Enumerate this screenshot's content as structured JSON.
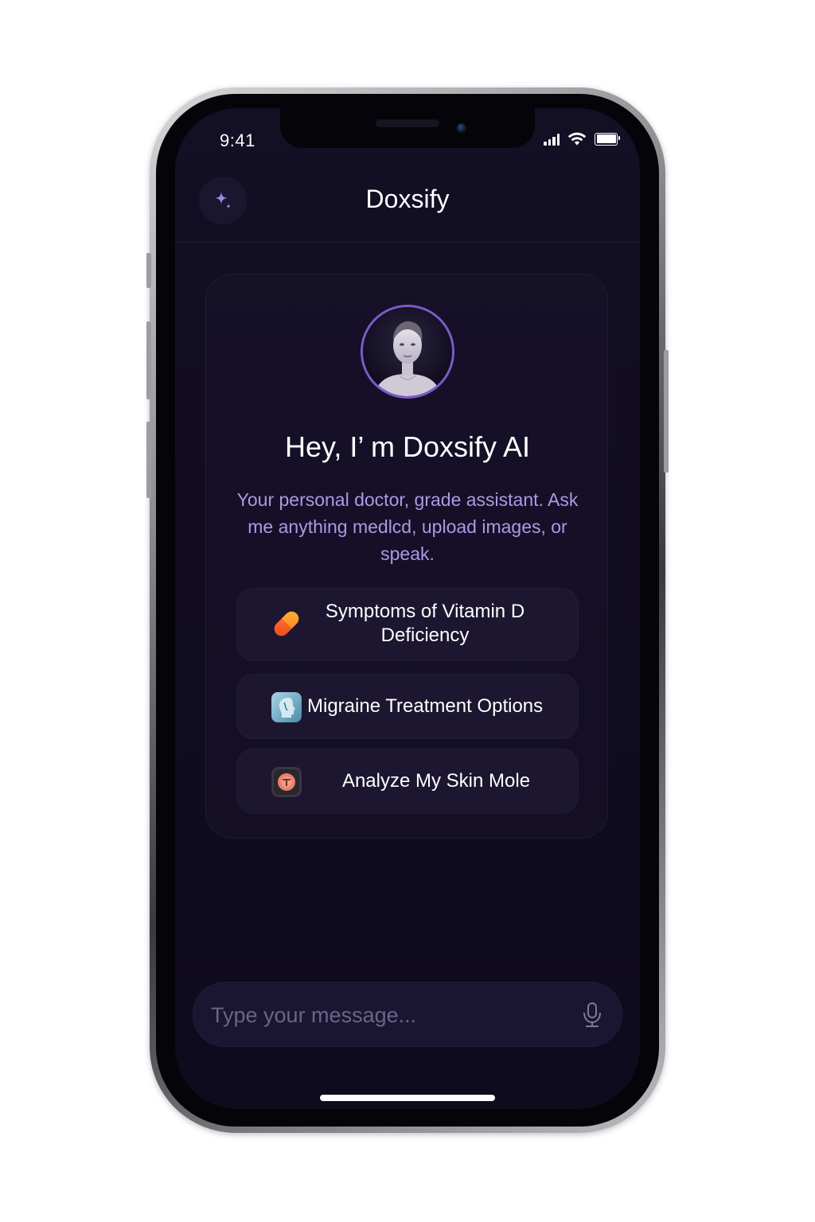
{
  "status_bar": {
    "time": "9:41",
    "signal_icon": "cellular-signal-icon",
    "wifi_icon": "wifi-icon",
    "battery_icon": "battery-icon"
  },
  "header": {
    "title": "Doxsify",
    "left_icon": "sparkle-icon"
  },
  "welcome": {
    "avatar_icon": "assistant-avatar",
    "heading": "Hey, I’ m Doxsify AI",
    "subtitle": "Your personal doctor, grade assistant. Ask me anything medlcd, upload images, or speak."
  },
  "suggestions": [
    {
      "label_line1": "Symptoms of Vitamin D",
      "label_line2": "Deficiency",
      "icon": "pill-icon"
    },
    {
      "label": "Migraine Treatment Options",
      "icon": "head-medical-icon"
    },
    {
      "label": "Analyze My Skin Mole",
      "icon": "skin-mole-icon"
    }
  ],
  "composer": {
    "placeholder": "Type your message...",
    "mic_icon": "microphone-icon"
  },
  "colors": {
    "accent": "#7d5bc7",
    "subtitle": "#a99be3",
    "background": "#110c22"
  }
}
